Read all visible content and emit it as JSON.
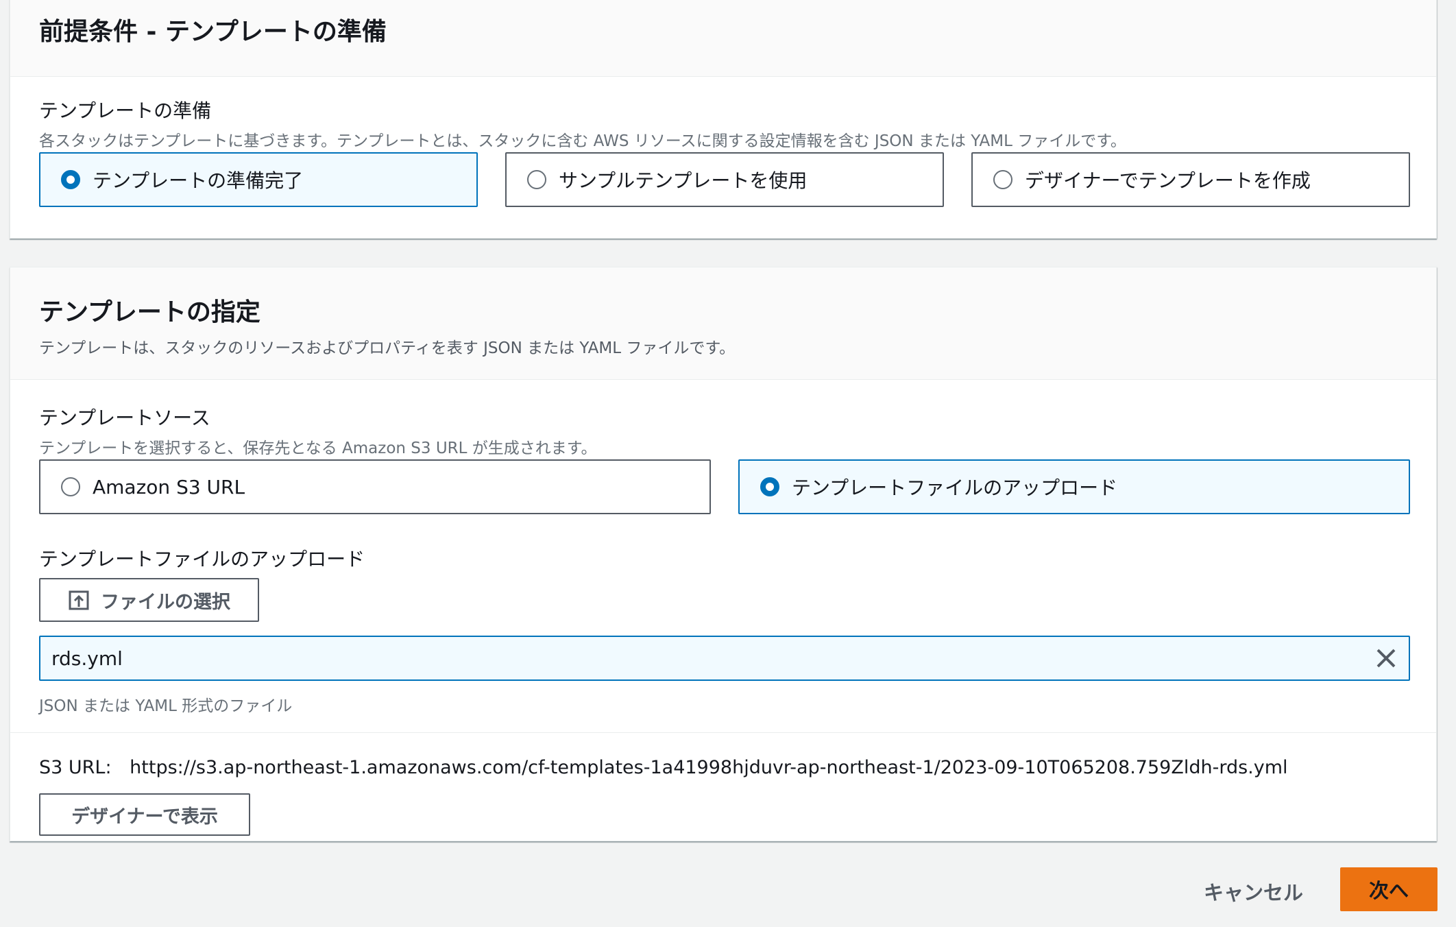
{
  "prereq": {
    "title": "前提条件 - テンプレートの準備",
    "field_label": "テンプレートの準備",
    "field_desc": "各スタックはテンプレートに基づきます。テンプレートとは、スタックに含む AWS リソースに関する設定情報を含む JSON または YAML ファイルです。",
    "options": [
      {
        "label": "テンプレートの準備完了",
        "selected": true
      },
      {
        "label": "サンプルテンプレートを使用",
        "selected": false
      },
      {
        "label": "デザイナーでテンプレートを作成",
        "selected": false
      }
    ]
  },
  "spec": {
    "title": "テンプレートの指定",
    "desc": "テンプレートは、スタックのリソースおよびプロパティを表す JSON または YAML ファイルです。",
    "source_label": "テンプレートソース",
    "source_desc": "テンプレートを選択すると、保存先となる Amazon S3 URL が生成されます。",
    "sources": [
      {
        "label": "Amazon S3 URL",
        "selected": false
      },
      {
        "label": "テンプレートファイルのアップロード",
        "selected": true
      }
    ],
    "upload_label": "テンプレートファイルのアップロード",
    "choose_file_button": "ファイルの選択",
    "file_value": "rds.yml",
    "file_hint": "JSON または YAML 形式のファイル",
    "s3_url_label": "S3 URL:",
    "s3_url_value": "https://s3.ap-northeast-1.amazonaws.com/cf-templates-1a41998hjduvr-ap-northeast-1/2023-09-10T065208.759Zldh-rds.yml",
    "designer_button": "デザイナーで表示"
  },
  "footer": {
    "cancel": "キャンセル",
    "next": "次へ"
  },
  "colors": {
    "accent": "#0073bb",
    "primary": "#ec7211",
    "selected_bg": "#f1faff"
  },
  "icons": {
    "upload": "upload-icon",
    "clear": "close-icon"
  }
}
